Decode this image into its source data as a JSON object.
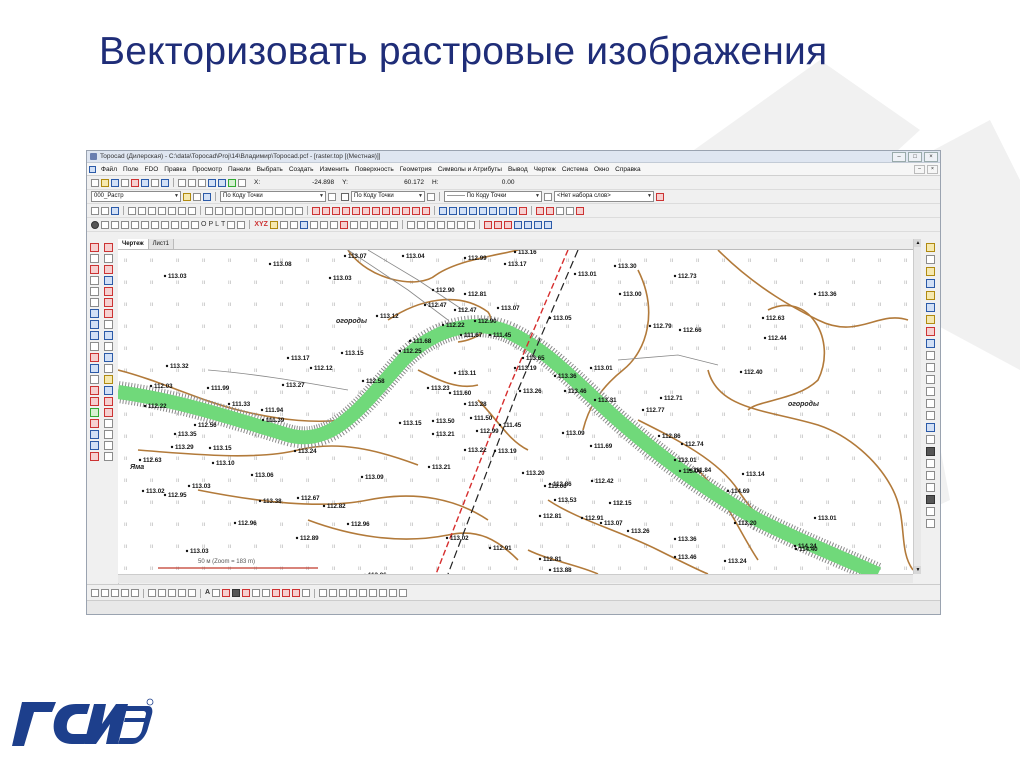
{
  "slide": {
    "title": "Векторизовать растровые изображения"
  },
  "colors": {
    "title": "#1f2d78",
    "water": "#70d97a",
    "contour": "#b27a3a",
    "road": "#d62d2d",
    "logo": "#1d3f8c"
  },
  "window": {
    "title": "Topocad (Дилерская) - C:\\data\\Topocad\\Proj\\14\\Владимир\\Topocad.pcf - [raster.top [(Местная)]]"
  },
  "menu": {
    "items": [
      "Файл",
      "Поле",
      "FDO",
      "Правка",
      "Просмотр",
      "Панели",
      "Выбрать",
      "Создать",
      "Изменить",
      "Поверхность",
      "Геометрия",
      "Символы и Атрибуты",
      "Вывод",
      "Чертеж",
      "Система",
      "Окно",
      "Справка"
    ]
  },
  "toolbar1": {
    "x_label": "X:",
    "x_value": "-24.898",
    "y_label": "Y:",
    "y_value": "60.172",
    "h_label": "H:",
    "h_value": "0.00"
  },
  "toolbar2": {
    "layer": "000_Растр",
    "by_code_1": "По Коду Точки",
    "by_code_2": "По Коду Точки",
    "line_by_code": "——— По Коду Точки",
    "wordset": "<Нет набора слов>"
  },
  "toolbar4": {
    "xyz_label": "XYZ",
    "letters": [
      "O",
      "P",
      "L",
      "T"
    ]
  },
  "doc_tabs": [
    "Чертеж",
    "Лист1"
  ],
  "icons": {
    "draw_tools": "draw-tools",
    "edit_tools": "edit-tools",
    "zoom_tools": "zoom-tools",
    "snap_tools": "snap-tools"
  },
  "map": {
    "labels_area": [
      "огороды",
      "огороды",
      "Яма"
    ],
    "scale_text": "50 м (Zoom = 183 m)",
    "point_labels": [
      "113.08",
      "113.07",
      "113.04",
      "112.99",
      "113.16",
      "113.17",
      "113.01",
      "112.73",
      "113.03",
      "113.03",
      "113.30",
      "113.00",
      "113.36",
      "112.90",
      "112.81",
      "112.47",
      "112.47",
      "113.07",
      "113.05",
      "112.63",
      "113.12",
      "112.22",
      "112.90",
      "112.79",
      "112.66",
      "112.44",
      "111.67",
      "111.68",
      "111.45",
      "113.17",
      "112.12",
      "113.15",
      "112.25",
      "113.65",
      "113.01",
      "112.40",
      "113.32",
      "113.11",
      "112.58",
      "113.27",
      "113.19",
      "113.36",
      "113.23",
      "111.60",
      "113.46",
      "113.26",
      "113.31",
      "112.71",
      "112.03",
      "111.99",
      "111.33",
      "113.28",
      "112.77",
      "112.22",
      "111.94",
      "111.39",
      "113.15",
      "113.50",
      "111.50",
      "112.99",
      "111.45",
      "113.09",
      "112.86",
      "112.74",
      "112.56",
      "113.35",
      "113.21",
      "113.22",
      "111.69",
      "113.01",
      "113.06",
      "113.29",
      "113.15",
      "113.24",
      "113.10",
      "113.19",
      "113.06",
      "111.84",
      "113.14",
      "112.63",
      "113.21",
      "113.20",
      "112.86",
      "112.42",
      "114.69",
      "113.06",
      "113.09",
      "113.02",
      "112.95",
      "113.03",
      "112.15",
      "112.67",
      "113.38",
      "112.82",
      "112.91",
      "113.53",
      "112.96",
      "112.96",
      "113.07",
      "112.81",
      "113.20",
      "113.01",
      "113.26",
      "113.02",
      "113.36",
      "114.24",
      "112.89",
      "112.91",
      "112.81",
      "113.46",
      "113.24",
      "114.40",
      "113.03",
      "113.06",
      "113.88"
    ]
  }
}
